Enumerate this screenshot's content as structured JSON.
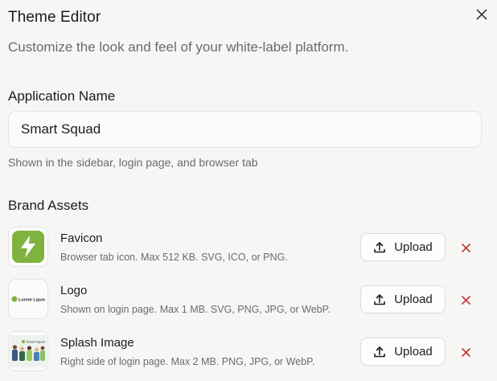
{
  "header": {
    "title": "Theme Editor",
    "subtitle": "Customize the look and feel of your white-label platform.",
    "close_icon": "close-icon"
  },
  "application": {
    "label": "Application Name",
    "value": "Smart Squad",
    "hint": "Shown in the sidebar, login page, and browser tab"
  },
  "brand_assets": {
    "label": "Brand Assets",
    "upload_label": "Upload",
    "remove_color": "#c23a3a",
    "items": [
      {
        "name": "Favicon",
        "description": "Browser tab icon. Max 512 KB. SVG, ICO, or PNG.",
        "thumb_icon": "lightning-bolt-icon",
        "thumb_color": "#7fb33d"
      },
      {
        "name": "Logo",
        "description": "Shown on login page. Max 1 MB. SVG, PNG, JPG, or WebP.",
        "thumb_icon": "logo-preview-icon",
        "thumb_text": "Lorem Lqsm"
      },
      {
        "name": "Splash Image",
        "description": "Right side of login page. Max 2 MB. PNG, JPG, or WebP.",
        "thumb_icon": "splash-preview-icon",
        "thumb_text": "Smart Squad"
      }
    ]
  }
}
